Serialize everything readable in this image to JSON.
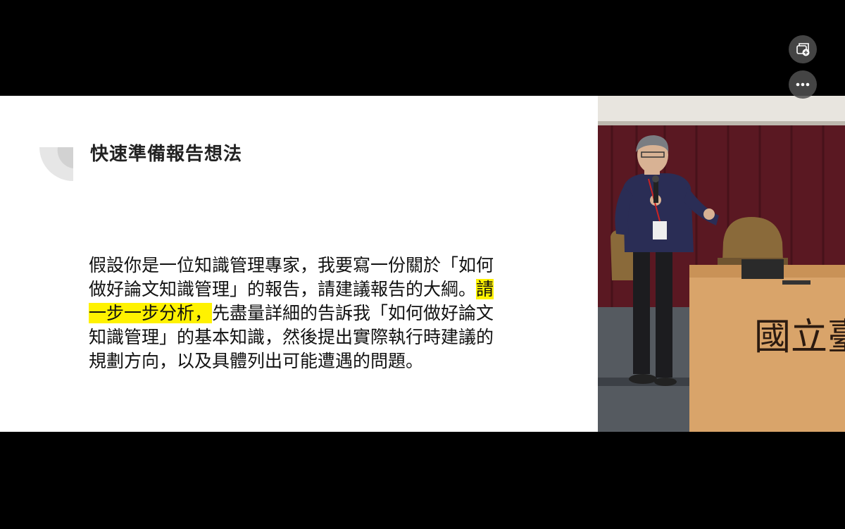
{
  "slide": {
    "title": "快速準備報告想法",
    "body_lines": [
      {
        "before": "假設你是一位知識管理專家，我要寫一份關於「如何",
        "highlight": "",
        "after": ""
      },
      {
        "before": "做好論文知識管理」的報告，請建議報告的大綱。",
        "highlight": "請",
        "after": ""
      },
      {
        "before": "",
        "highlight": "一步一步分析，",
        "after": "先盡量詳細的告訴我「如何做好論文"
      },
      {
        "before": "知識管理」的基本知識，然後提出實際執行時建議的",
        "highlight": "",
        "after": ""
      },
      {
        "before": "規劃方向，以及具體列出可能遭遇的問題。",
        "highlight": "",
        "after": ""
      }
    ]
  },
  "camera": {
    "podium_text": "國立臺"
  },
  "controls": {
    "pip_icon": "add-to-queue-icon",
    "more_icon": "more-horizontal-icon"
  },
  "colors": {
    "highlight": "#fff200",
    "curtain": "#5a1822",
    "podium": "#d9a46a"
  }
}
